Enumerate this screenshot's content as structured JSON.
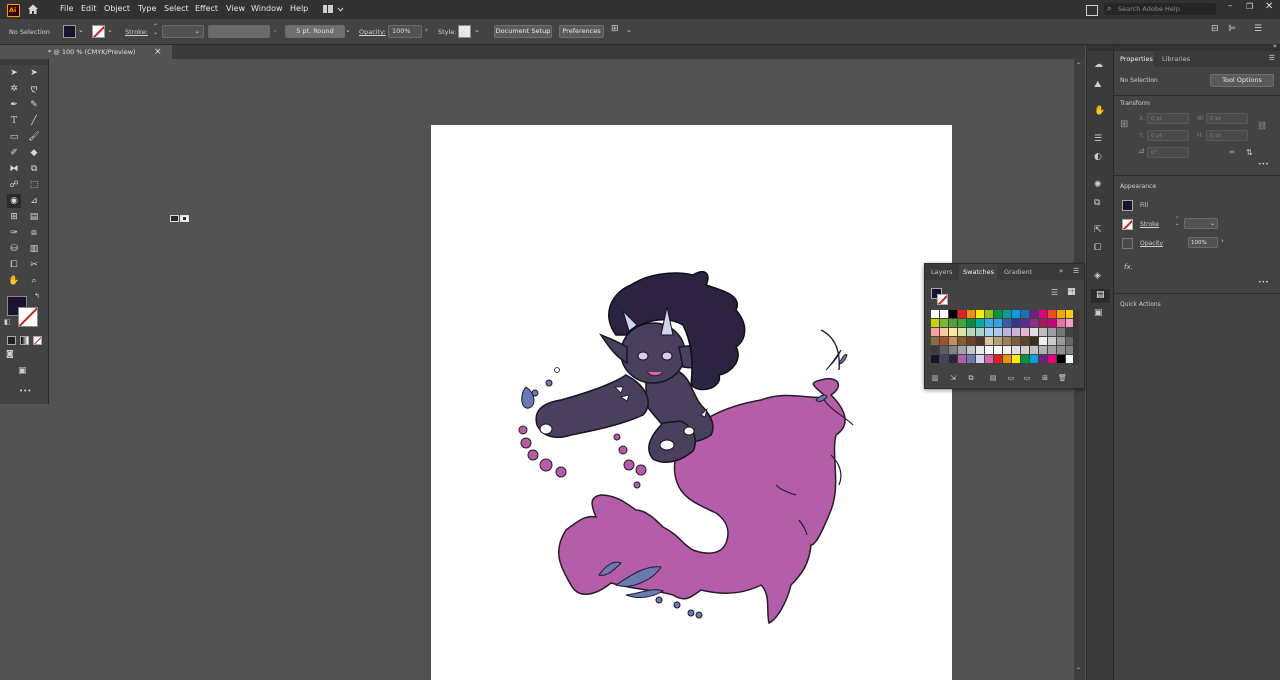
{
  "menubar": {
    "app_icon": "Ai",
    "items": [
      "File",
      "Edit",
      "Object",
      "Type",
      "Select",
      "Effect",
      "View",
      "Window",
      "Help"
    ],
    "search_placeholder": "Search Adobe Help"
  },
  "control_bar": {
    "selection_status": "No Selection",
    "stroke_label": "Stroke:",
    "brush_value": "5 pt. Round",
    "opacity_label": "Opacity:",
    "opacity_value": "100%",
    "style_label": "Style:",
    "document_setup": "Document Setup",
    "preferences": "Preferences"
  },
  "document_tab": {
    "title": "* @ 100 % (CMYK/Preview)",
    "close": "×"
  },
  "properties_panel": {
    "tabs": [
      "Properties",
      "Libraries"
    ],
    "selection_status": "No Selection",
    "tool_options": "Tool Options",
    "transform": {
      "heading": "Transform",
      "x_label": "X:",
      "x_value": "0 pt",
      "y_label": "Y:",
      "y_value": "0 pt",
      "w_label": "W:",
      "w_value": "0 pt",
      "h_label": "H:",
      "h_value": "0 pt",
      "angle_value": "0°"
    },
    "appearance": {
      "heading": "Appearance",
      "fill_label": "Fill",
      "stroke_label": "Stroke",
      "opacity_label": "Opacity",
      "opacity_value": "100%",
      "fx_label": "fx."
    },
    "quick_actions": "Quick Actions",
    "more": "•••"
  },
  "swatches_panel": {
    "tabs": [
      "Layers",
      "Swatches",
      "Gradient"
    ],
    "active_tab": "Swatches",
    "menu_icon": "hamburger-menu-icon"
  },
  "toolbar": {
    "fill_color": "#1c1230",
    "stroke_color": "#cc2b2b",
    "more": "•••"
  },
  "colors": {
    "app_bg": "#535353",
    "menubar_bg": "#323232",
    "panel_bg": "#434343",
    "artboard": "#ffffff",
    "tail_pink": "#b45eaa",
    "body_purple": "#4b3f5e",
    "hair": "#2d2340",
    "water_blue": "#6d79b3"
  }
}
